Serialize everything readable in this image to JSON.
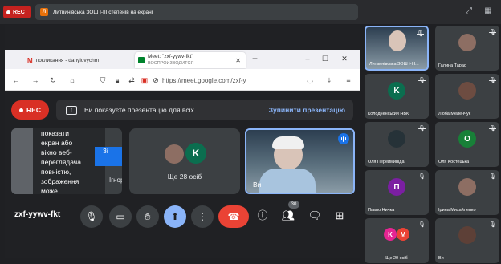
{
  "topbar": {
    "rec_label": "REC",
    "presenting_icon_letter": "Л",
    "presenting_text": "Литвинівська ЗОШ І-ІІІ степенів на екрані"
  },
  "browser": {
    "tab1_title": "покликання - danylovychm",
    "tab2_title": "Meet: \"zxf-yywv-fkt\"",
    "tab2_subtitle": "ВОСПРОИЗВОДИТСЯ",
    "new_tab": "+",
    "url": "https://meet.google.com/zxf-y"
  },
  "presentation": {
    "rec_label": "REC",
    "banner_text": "Ви показуєте презентацію для всіх",
    "stop_label": "Зупинити презентацію"
  },
  "screen_share": {
    "text_lines": [
      "показати",
      "екран або",
      "вікно веб-",
      "переглядача",
      "повністю,",
      "зображення",
      "може"
    ],
    "blue_text": "Зі",
    "ignore_text": "Ігнору"
  },
  "others_tile": {
    "avatar_letter": "K",
    "label": "Ще 28 осіб"
  },
  "self_tile": {
    "label": "Ви"
  },
  "bottom": {
    "meeting_code": "zxf-yywv-fkt",
    "people_count": "30"
  },
  "gallery": [
    {
      "name": "Литвинівська ЗОШ І-ІІІ...",
      "avatar": "",
      "color": "#1e3a5f",
      "type": "video"
    },
    {
      "name": "Галина Тарас",
      "avatar": "",
      "color": "#8d6e63",
      "type": "photo"
    },
    {
      "name": "Колодненський НВК",
      "avatar": "K",
      "color": "#0b6e4f",
      "type": "letter"
    },
    {
      "name": "Люба Меленчук",
      "avatar": "",
      "color": "#6d4c41",
      "type": "photo"
    },
    {
      "name": "Оля Перейминіда",
      "avatar": "",
      "color": "#263238",
      "type": "photo"
    },
    {
      "name": "Оля Костецька",
      "avatar": "O",
      "color": "#188038",
      "type": "letter"
    },
    {
      "name": "Павло Ничка",
      "avatar": "П",
      "color": "#7b1fa2",
      "type": "letter"
    },
    {
      "name": "Ірина Михайленко",
      "avatar": "",
      "color": "#8d6e63",
      "type": "photo"
    },
    {
      "name": "Ще 20 осіб",
      "avatar": "K",
      "color": "#e52592",
      "type": "multi",
      "avatar2": "M"
    },
    {
      "name": "Ви",
      "avatar": "",
      "color": "#5d4037",
      "type": "photo"
    }
  ]
}
